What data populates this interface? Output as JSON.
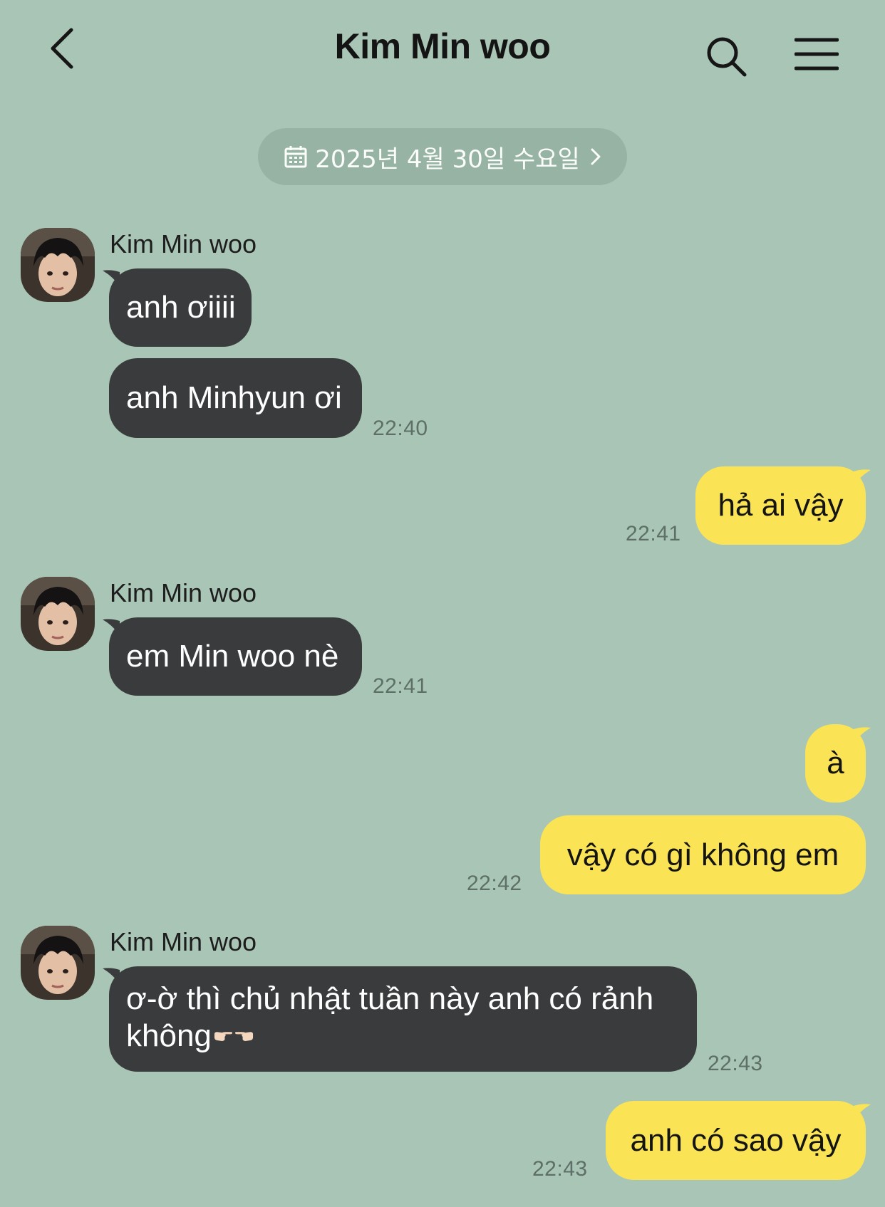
{
  "header": {
    "back_icon": "chevron-left-icon",
    "title": "Kim Min woo",
    "search_icon": "search-icon",
    "menu_icon": "hamburger-menu-icon"
  },
  "date_divider": {
    "icon": "calendar-icon",
    "label": "2025년 4월 30일 수요일",
    "chevron": "chevron-right-icon"
  },
  "contact": {
    "name": "Kim Min woo"
  },
  "messages": [
    {
      "sender": "Kim Min woo",
      "direction": "incoming",
      "text": "anh ơiiii",
      "time": ""
    },
    {
      "sender": "Kim Min woo",
      "direction": "incoming",
      "text": "anh Minhyun ơi",
      "time": "22:40"
    },
    {
      "sender": "me",
      "direction": "outgoing",
      "text": "hả ai vậy",
      "time": "22:41"
    },
    {
      "sender": "Kim Min woo",
      "direction": "incoming",
      "text": "em Min woo nè",
      "time": "22:41"
    },
    {
      "sender": "me",
      "direction": "outgoing",
      "text": "à",
      "time": ""
    },
    {
      "sender": "me",
      "direction": "outgoing",
      "text": "vậy có gì không em",
      "time": "22:42"
    },
    {
      "sender": "Kim Min woo",
      "direction": "incoming",
      "text": "ơ-ờ thì chủ nhật tuần này anh có rảnh",
      "text_line2": "không",
      "emoji": "pointing-fingers-emoji",
      "time": "22:43"
    },
    {
      "sender": "me",
      "direction": "outgoing",
      "text": "anh có sao vậy",
      "time": "22:43"
    }
  ],
  "colors": {
    "background": "#a8c5b6",
    "incoming_bubble": "#3a3b3d",
    "outgoing_bubble": "#fae455",
    "timestamp": "#5d6f66"
  }
}
